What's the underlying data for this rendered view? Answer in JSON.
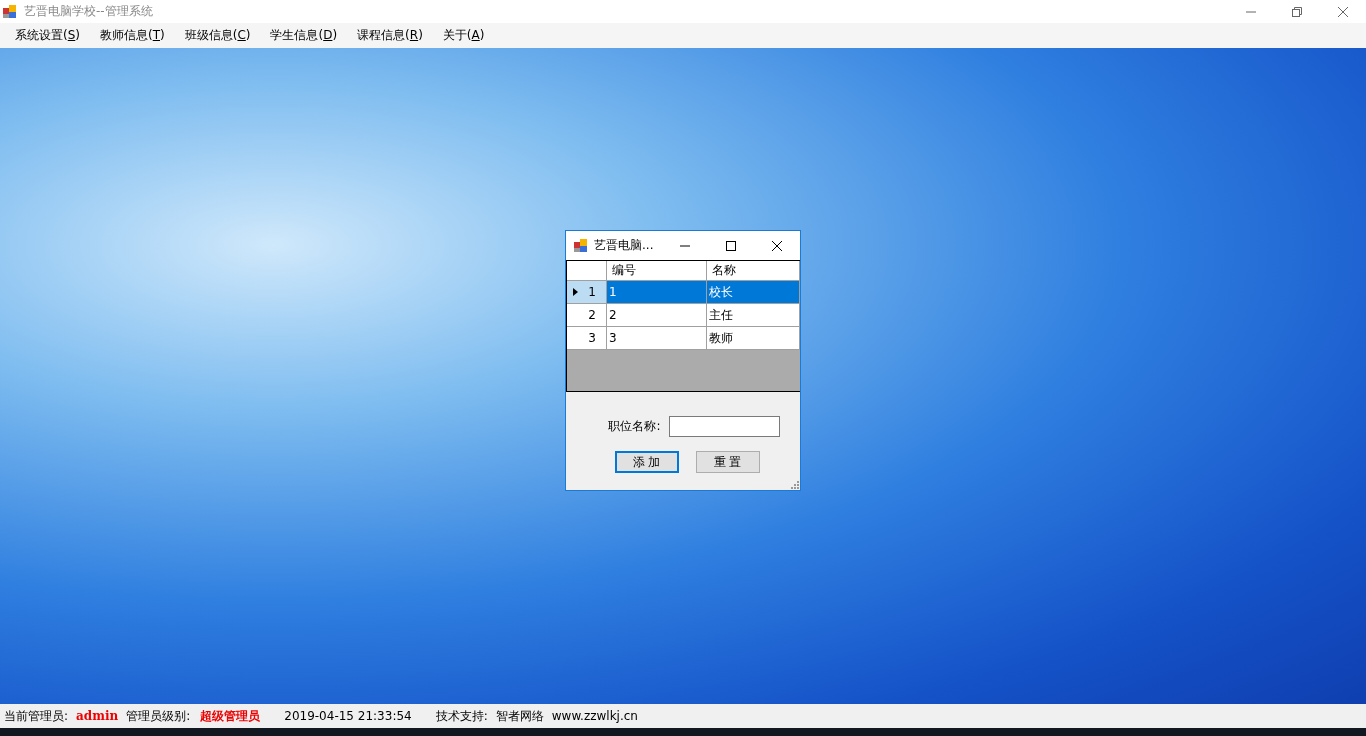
{
  "window": {
    "title": "艺晋电脑学校--管理系统"
  },
  "menu": [
    {
      "before": "系统设置(",
      "key": "S",
      "after": ")"
    },
    {
      "before": "教师信息(",
      "key": "T",
      "after": ")"
    },
    {
      "before": "班级信息(",
      "key": "C",
      "after": ")"
    },
    {
      "before": "学生信息(",
      "key": "D",
      "after": ")"
    },
    {
      "before": "课程信息(",
      "key": "R",
      "after": ")"
    },
    {
      "before": "关于(",
      "key": "A",
      "after": ")"
    }
  ],
  "dialog": {
    "title": "艺晋电脑...",
    "table": {
      "columns": [
        "编号",
        "名称"
      ],
      "rows": [
        {
          "number": "1",
          "cells": [
            "1",
            "校长"
          ],
          "selected": true
        },
        {
          "number": "2",
          "cells": [
            "2",
            "主任"
          ],
          "selected": false
        },
        {
          "number": "3",
          "cells": [
            "3",
            "教师"
          ],
          "selected": false
        }
      ]
    },
    "field": {
      "label": "职位名称:"
    },
    "buttons": [
      {
        "label": "添 加",
        "focused": true
      },
      {
        "label": "重 置",
        "focused": false
      }
    ]
  },
  "status_bar": [
    {
      "text": "当前管理员:",
      "emphasis": false
    },
    {
      "text": "admin",
      "emphasis": true
    },
    {
      "text": "管理员级别:",
      "emphasis": false
    },
    {
      "text": "超级管理员",
      "emphasis": true
    },
    {
      "text": "2019-04-15 21:33:54",
      "emphasis": false
    },
    {
      "text": "技术支持:",
      "emphasis": false
    },
    {
      "text": "智者网络",
      "emphasis": false
    },
    {
      "text": "www.zzwlkj.cn",
      "emphasis": false
    }
  ]
}
